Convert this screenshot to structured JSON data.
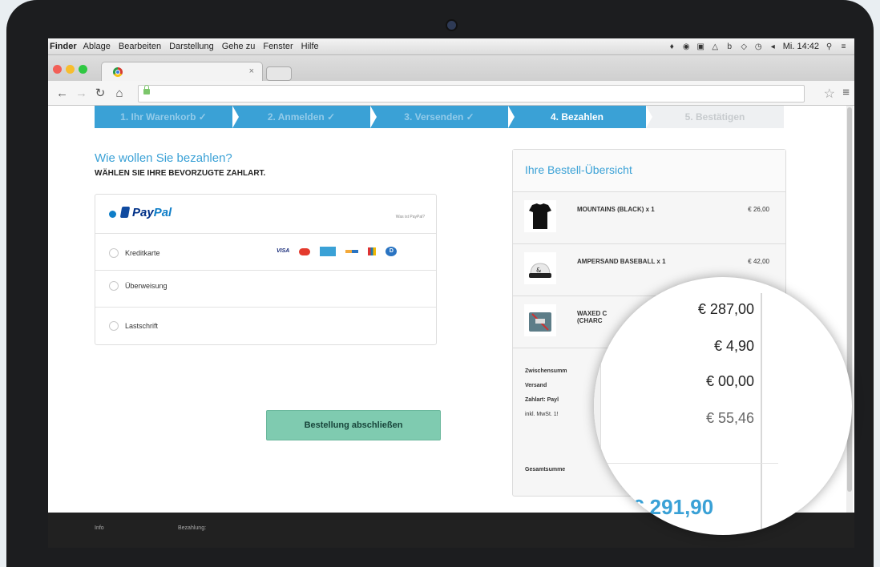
{
  "menubar": {
    "app": "Finder",
    "items": [
      "Ablage",
      "Bearbeiten",
      "Darstellung",
      "Gehe zu",
      "Fenster",
      "Hilfe"
    ],
    "clock": "Mi. 14:42"
  },
  "browser": {
    "tab_close": "×"
  },
  "steps": [
    {
      "label": "1. Ihr Warenkorb ✓",
      "state": "done"
    },
    {
      "label": "2. Anmelden ✓",
      "state": "done"
    },
    {
      "label": "3. Versenden ✓",
      "state": "done"
    },
    {
      "label": "4. Bezahlen",
      "state": "active"
    },
    {
      "label": "5. Bestätigen",
      "state": "future"
    }
  ],
  "payment": {
    "title": "Wie wollen Sie bezahlen?",
    "subtitle": "WÄHLEN SIE IHRE BEVORZUGTE ZAHLART.",
    "paypal": {
      "label_pay": "Pay",
      "label_pal": "Pal",
      "what": "Was ist PayPal?"
    },
    "options": [
      {
        "label": "Kreditkarte"
      },
      {
        "label": "Überweisung"
      },
      {
        "label": "Lastschrift"
      }
    ],
    "cards": [
      "VISA",
      "mastercard",
      "AMERICAN EXPRESS",
      "maestro",
      "cb",
      "diners"
    ],
    "submit": "Bestellung abschließen"
  },
  "summary": {
    "title": "Ihre Bestell-Übersicht",
    "items": [
      {
        "name": "MOUNTAINS (BLACK) x 1",
        "price": "€ 26,00"
      },
      {
        "name": "AMPERSAND BASEBALL x 1",
        "price": "€ 42,00"
      },
      {
        "name": "WAXED C",
        "name2": "(CHARC",
        "price": ""
      }
    ],
    "rows": [
      "Zwischensumm",
      "Versand",
      "Zahlart: Payl",
      "inkl. MwSt. 1!"
    ],
    "total_label": "Gesamtsumme"
  },
  "magnifier": {
    "values": [
      "€ 287,00",
      "€ 4,90",
      "€ 00,00",
      "€ 55,46"
    ],
    "grand_total": "€ 291,90"
  },
  "footer": {
    "col1": "Info",
    "col2": "Bezahlung:"
  },
  "colors": {
    "accent": "#3aa1d6",
    "button": "#7fcbb0",
    "footer": "#212121"
  }
}
